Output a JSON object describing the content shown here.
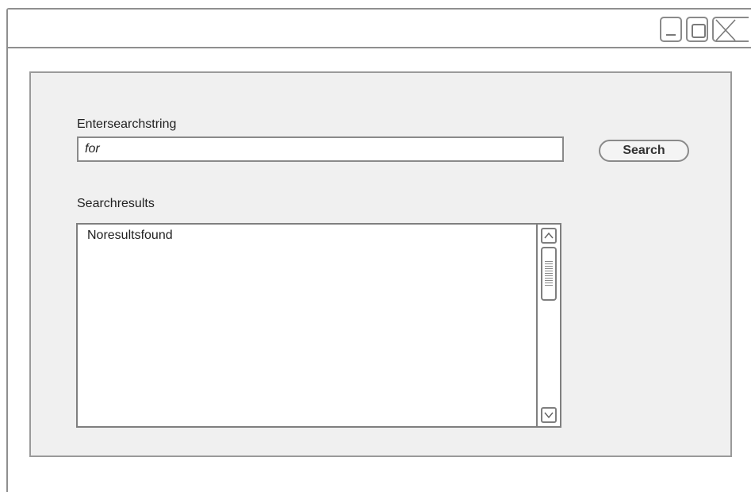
{
  "window": {
    "controls": {
      "minimize_icon": "minimize-icon",
      "maximize_icon": "maximize-icon",
      "close_icon": "close-icon"
    }
  },
  "search": {
    "label": "Entersearchstring",
    "value": "for",
    "button_label": "Search"
  },
  "results": {
    "label": "Searchresults",
    "items": [
      "Noresultsfound"
    ]
  },
  "colors": {
    "border": "#8f8f8f",
    "panel_background": "#f0f0f0"
  }
}
